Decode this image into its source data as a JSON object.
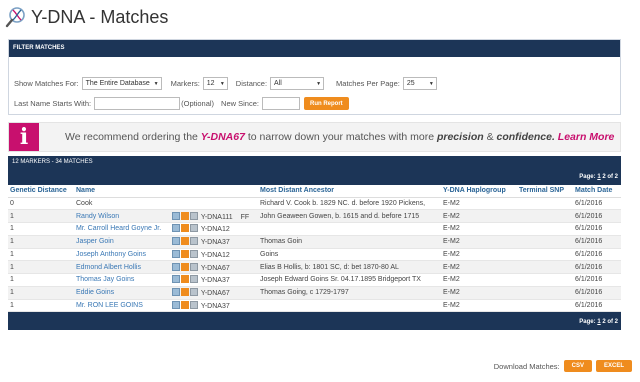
{
  "header": {
    "title": "Y-DNA - Matches"
  },
  "filter": {
    "heading": "FILTER MATCHES",
    "show_for_label": "Show Matches For:",
    "show_for_value": "The Entire Database",
    "markers_label": "Markers:",
    "markers_value": "12",
    "distance_label": "Distance:",
    "distance_value": "All",
    "per_page_label": "Matches Per Page:",
    "per_page_value": "25",
    "last_name_label": "Last Name Starts With:",
    "last_name_value": "",
    "optional_label": "(Optional)",
    "new_since_label": "New Since:",
    "new_since_value": "",
    "run_label": "Run Report"
  },
  "recommend": {
    "icon": "info-icon",
    "text_1": "We recommend ordering the",
    "product": "Y-DNA67",
    "text_2": "to narrow down your matches with more",
    "word_1": "precision",
    "amp": "&",
    "word_2": "confidence.",
    "link": "Learn More"
  },
  "results": {
    "heading": "12 MARKERS - 34 MATCHES",
    "page_label": "Page:",
    "page_current": "1",
    "page_of": "2 of 2",
    "columns": [
      "Genetic Distance",
      "Name",
      "",
      "Most Distant Ancestor",
      "Y-DNA Haplogroup",
      "Terminal SNP",
      "Match Date"
    ],
    "rows": [
      {
        "distance": "0",
        "name": "Cook",
        "link": false,
        "test": "",
        "ff": "",
        "ancestor": "Richard V. Cook b. 1829 NC. d. before 1920 Pickens,",
        "haplogroup": "E-M2",
        "snp": "",
        "date": "6/1/2016"
      },
      {
        "distance": "1",
        "name": "Randy Wilson",
        "link": true,
        "test": "Y-DNA111",
        "ff": "FF",
        "ancestor": "John Geaween Gowen, b. 1615 and d. before 1715",
        "haplogroup": "E-M2",
        "snp": "",
        "date": "6/1/2016"
      },
      {
        "distance": "1",
        "name": "Mr. Carroll Heard Goyne Jr.",
        "link": true,
        "test": "Y-DNA12",
        "ff": "",
        "ancestor": "",
        "haplogroup": "E-M2",
        "snp": "",
        "date": "6/1/2016"
      },
      {
        "distance": "1",
        "name": "Jasper Goin",
        "link": true,
        "test": "Y-DNA37",
        "ff": "",
        "ancestor": "Thomas Goin",
        "haplogroup": "E-M2",
        "snp": "",
        "date": "6/1/2016"
      },
      {
        "distance": "1",
        "name": "Joseph Anthony Goins",
        "link": true,
        "test": "Y-DNA12",
        "ff": "",
        "ancestor": "Goins",
        "haplogroup": "E-M2",
        "snp": "",
        "date": "6/1/2016"
      },
      {
        "distance": "1",
        "name": "Edmond Albert Hollis",
        "link": true,
        "test": "Y-DNA67",
        "ff": "",
        "ancestor": "Elias B Hollis, b: 1801 SC, d: bet 1870-80 AL",
        "haplogroup": "E-M2",
        "snp": "",
        "date": "6/1/2016"
      },
      {
        "distance": "1",
        "name": "Thomas Jay Goins",
        "link": true,
        "test": "Y-DNA37",
        "ff": "",
        "ancestor": "Joseph Edward Goins Sr. 04.17.1895 Bridgeport TX",
        "haplogroup": "E-M2",
        "snp": "",
        "date": "6/1/2016"
      },
      {
        "distance": "1",
        "name": "Eddie Goins",
        "link": true,
        "test": "Y-DNA67",
        "ff": "",
        "ancestor": "Thomas Going, c 1729-1797",
        "haplogroup": "E-M2",
        "snp": "",
        "date": "6/1/2016"
      },
      {
        "distance": "1",
        "name": "Mr. RON LEE GOINS",
        "link": true,
        "test": "Y-DNA37",
        "ff": "",
        "ancestor": "",
        "haplogroup": "E-M2",
        "snp": "",
        "date": "6/1/2016"
      }
    ]
  },
  "download": {
    "label": "Download Matches:",
    "csv": "CSV",
    "excel": "EXCEL"
  }
}
